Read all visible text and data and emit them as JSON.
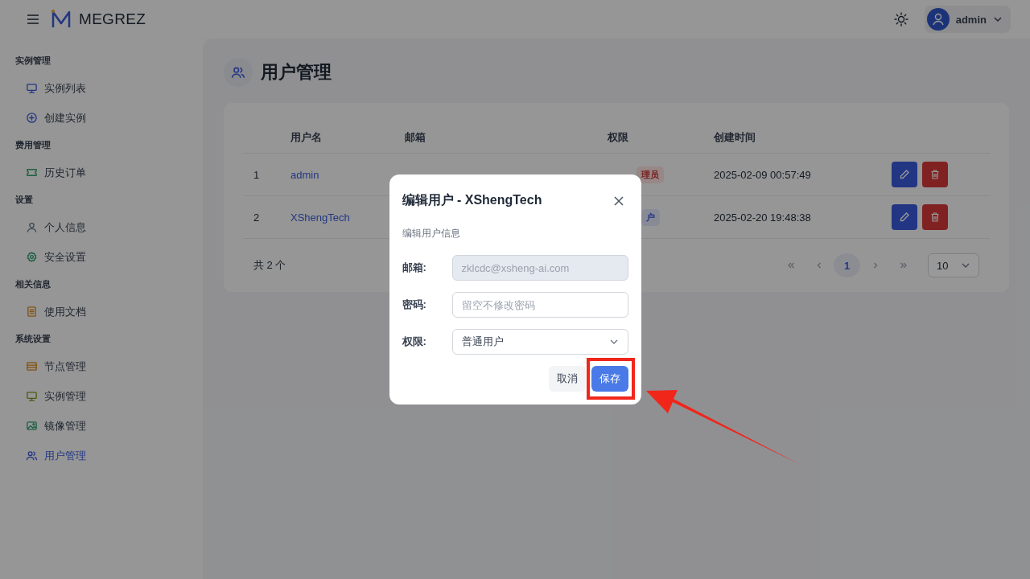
{
  "header": {
    "brand": "MEGREZ",
    "user": "admin"
  },
  "sidebar": {
    "groups": [
      {
        "title": "实例管理",
        "items": [
          {
            "label": "实例列表",
            "kind": "monitor",
            "selected": false
          },
          {
            "label": "创建实例",
            "kind": "plus",
            "selected": false
          }
        ]
      },
      {
        "title": "费用管理",
        "items": [
          {
            "label": "历史订单",
            "kind": "ticket",
            "selected": false
          }
        ]
      },
      {
        "title": "设置",
        "items": [
          {
            "label": "个人信息",
            "kind": "user",
            "selected": false
          },
          {
            "label": "安全设置",
            "kind": "gear",
            "selected": false
          }
        ]
      },
      {
        "title": "相关信息",
        "items": [
          {
            "label": "使用文档",
            "kind": "doc",
            "selected": false
          }
        ]
      },
      {
        "title": "系统设置",
        "items": [
          {
            "label": "节点管理",
            "kind": "server",
            "selected": false
          },
          {
            "label": "实例管理",
            "kind": "monitor2",
            "selected": false
          },
          {
            "label": "镜像管理",
            "kind": "image",
            "selected": false
          },
          {
            "label": "用户管理",
            "kind": "users",
            "selected": true
          }
        ]
      }
    ]
  },
  "page_title": "用户管理",
  "table": {
    "columns": [
      "用户名",
      "邮箱",
      "权限",
      "创建时间"
    ],
    "rows": [
      {
        "index": "1",
        "username": "admin",
        "role": "理员",
        "kind": "admin",
        "created": "2025-02-09 00:57:49"
      },
      {
        "index": "2",
        "username": "XShengTech",
        "role": "户",
        "kind": "user",
        "created": "2025-02-20 19:48:38"
      }
    ]
  },
  "pagination": {
    "total": "共 2 个",
    "pages": [
      {
        "label": "1",
        "selected": true
      }
    ],
    "page_size": "10"
  },
  "dialog": {
    "title": "编辑用户 - XShengTech",
    "subtitle": "编辑用户信息",
    "fields": [
      {
        "label": "邮箱:",
        "kind": "text",
        "value": "zklcdc@xsheng-ai.com",
        "disabled": true
      },
      {
        "label": "密码:",
        "kind": "password",
        "placeholder": "留空不修改密码",
        "disabled": false
      },
      {
        "label": "权限:",
        "kind": "select",
        "value": "普通用户",
        "disabled": false
      }
    ],
    "buttons": [
      {
        "label": "取消",
        "kind": "secondary"
      },
      {
        "label": "保存",
        "kind": "primary"
      }
    ]
  }
}
